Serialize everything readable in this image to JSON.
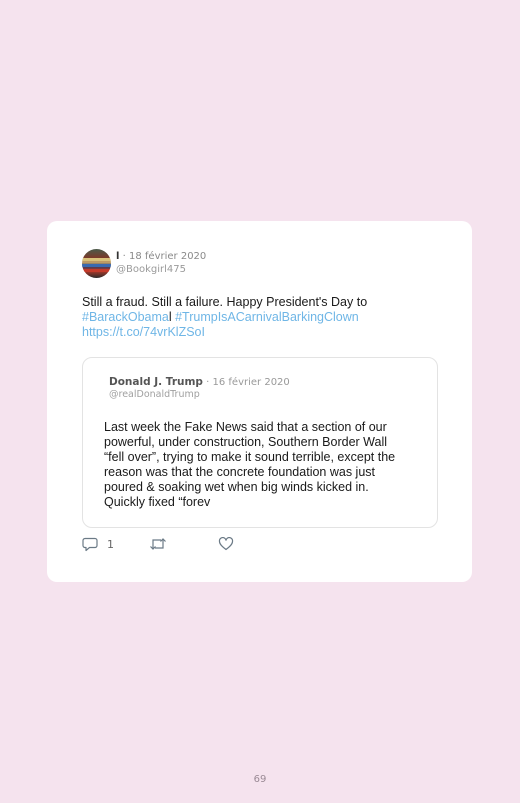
{
  "tweet": {
    "author_name": "l",
    "separator": "·",
    "date": "18 février 2020",
    "handle": "@Bookgirl475",
    "text_line1": "Still a fraud. Still a failure. Happy President's Day to",
    "hashtag1": "#BarackObama",
    "text_mid": "l ",
    "hashtag2": "#TrumpIsACarnivalBarkingClown",
    "link": "https://t.co/74vrKlZSoI"
  },
  "quoted_tweet": {
    "author_name": "Donald J. Trump",
    "separator": "·",
    "date": "16 février 2020",
    "handle": "@realDonaldTrump",
    "text_lines": [
      "Last week the Fake News said that a section of our",
      "powerful, under construction, Southern Border Wall",
      "“fell over”, trying to make it sound terrible, except the",
      "reason was that the concrete foundation was just",
      "poured & soaking wet when big winds kicked in.",
      "Quickly fixed “forev"
    ]
  },
  "actions": {
    "reply_count": "1",
    "reply_icon": "reply-icon",
    "retweet_icon": "retweet-icon",
    "like_icon": "heart-icon"
  },
  "page_number": "69",
  "colors": {
    "background": "#f5e3ee",
    "card": "#ffffff",
    "link": "#6fb6e6"
  }
}
